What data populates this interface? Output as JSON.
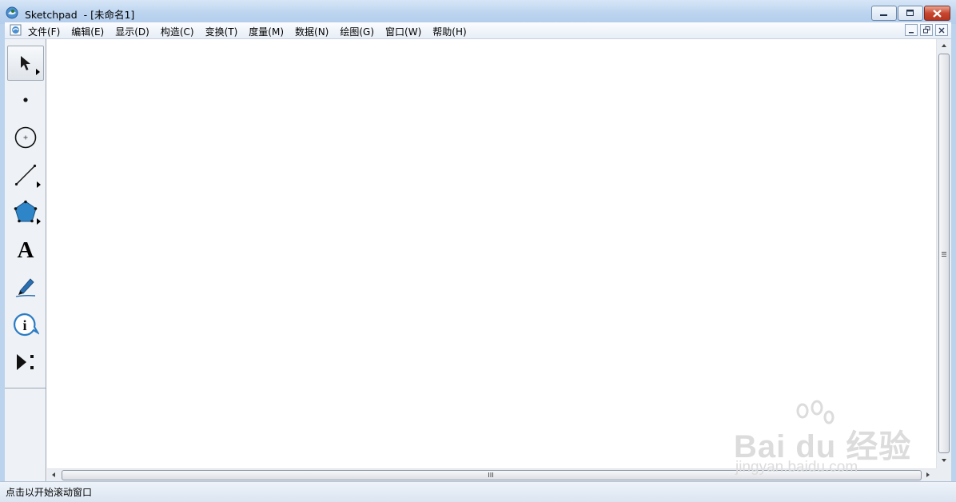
{
  "window": {
    "title": "Sketchpad  - [未命名1]",
    "icons": {
      "app": "sketchpad-globe-icon",
      "minimize": "minimize-icon",
      "maximize": "maximize-icon",
      "close": "close-icon"
    }
  },
  "menubar": {
    "items": [
      {
        "label": "文件(F)"
      },
      {
        "label": "编辑(E)"
      },
      {
        "label": "显示(D)"
      },
      {
        "label": "构造(C)"
      },
      {
        "label": "变换(T)"
      },
      {
        "label": "度量(M)"
      },
      {
        "label": "数据(N)"
      },
      {
        "label": "绘图(G)"
      },
      {
        "label": "窗口(W)"
      },
      {
        "label": "帮助(H)"
      }
    ]
  },
  "toolbox": {
    "tools": [
      {
        "name": "arrow-tool",
        "icon": "arrow-pointer-icon",
        "selected": true
      },
      {
        "name": "point-tool",
        "icon": "point-icon"
      },
      {
        "name": "compass-tool",
        "icon": "circle-icon"
      },
      {
        "name": "straightedge-tool",
        "icon": "line-segment-icon"
      },
      {
        "name": "polygon-tool",
        "icon": "pentagon-icon"
      },
      {
        "name": "text-tool",
        "icon": "text-a-icon",
        "glyph": "A"
      },
      {
        "name": "marker-tool",
        "icon": "marker-pen-icon"
      },
      {
        "name": "information-tool",
        "icon": "info-icon",
        "glyph": "i"
      },
      {
        "name": "custom-tool",
        "icon": "custom-tool-icon"
      }
    ]
  },
  "statusbar": {
    "text": "点击以开始滚动窗口"
  },
  "watermark": {
    "main": "Bai du 经验",
    "sub": "jingyan.baidu.com"
  },
  "colors": {
    "polygon_fill": "#2e86c9",
    "marker_blue": "#2a6fb2",
    "info_blue": "#2b7cc4"
  }
}
